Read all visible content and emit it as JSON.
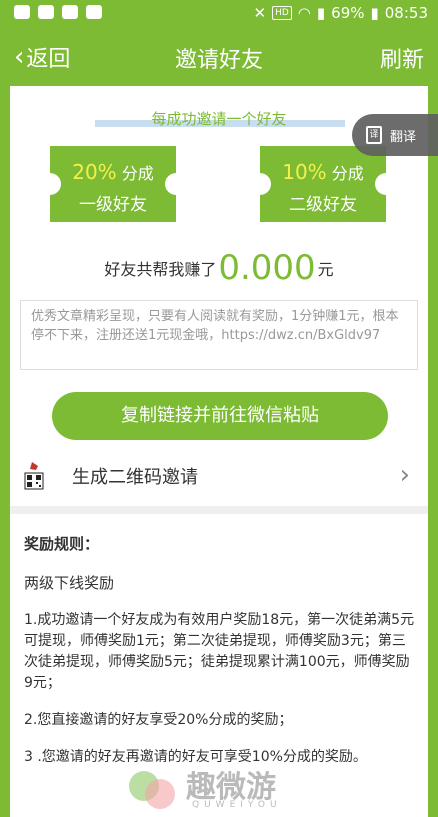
{
  "status_bar": {
    "battery": "69%",
    "time": "08:53",
    "hd": "HD"
  },
  "nav": {
    "back_label": "返回",
    "title": "邀请好友",
    "refresh_label": "刷新"
  },
  "banner": {
    "title": "每成功邀请一个好友"
  },
  "tickets": [
    {
      "percent": "20%",
      "share": "分成",
      "level": "一级好友"
    },
    {
      "percent": "10%",
      "share": "分成",
      "level": "二级好友"
    }
  ],
  "earnings": {
    "prefix": "好友共帮我赚了",
    "amount": "0.000",
    "unit": "元"
  },
  "invite_text": "优秀文章精彩呈现，只要有人阅读就有奖励，1分钟赚1元，根本停不下来，注册还送1元现金哦，https://dwz.cn/BxGldv97",
  "copy_button": "复制链接并前往微信粘贴",
  "qr_row": {
    "label": "生成二维码邀请"
  },
  "rules": {
    "title": "奖励规则：",
    "subtitle": "两级下线奖励",
    "items": [
      "1.成功邀请一个好友成为有效用户奖励18元，第一次徒弟满5元可提现，师傅奖励1元；第二次徒弟提现，师傅奖励3元；第三次徒弟提现，师傅奖励5元；徒弟提现累计满100元，师傅奖励9元；",
      "2.您直接邀请的好友享受20%分成的奖励；",
      "3 .您邀请的好友再邀请的好友可享受10%分成的奖励。"
    ]
  },
  "translate": {
    "label": "翻译",
    "icon_text": "译"
  },
  "watermark": {
    "brand": "趣微游",
    "sub": "QUWEIYOU"
  },
  "colors": {
    "accent": "#7cbb33",
    "amount": "#7cbb33",
    "highlight": "#f3f04a"
  }
}
